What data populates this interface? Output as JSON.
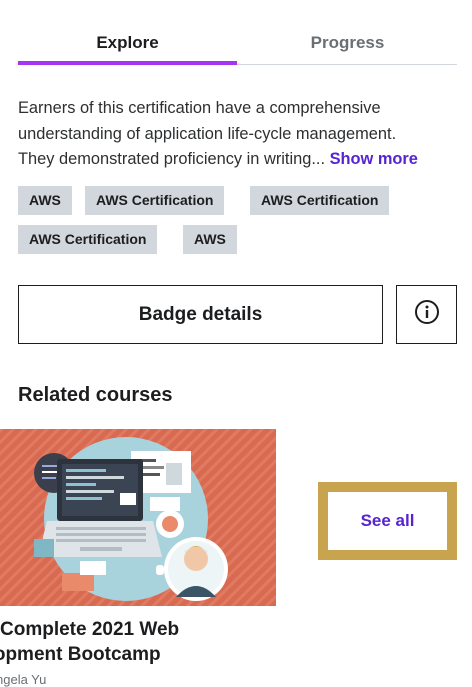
{
  "tabs": [
    {
      "label": "Explore",
      "active": true
    },
    {
      "label": "Progress",
      "active": false
    }
  ],
  "description": {
    "line1": "Earners of this certification have a comprehensive",
    "line2": "understanding of application life-cycle management.",
    "line3": "They demonstrated proficiency in writing...",
    "show_more": "Show more"
  },
  "tags": [
    "AWS",
    "AWS Certification",
    "AWS Certification",
    "AWS Certification",
    "AWS"
  ],
  "actions": {
    "badge_details": "Badge details",
    "info_icon": "info-circle-icon"
  },
  "related": {
    "title": "Related courses",
    "course": {
      "title_line1": "Complete 2021 Web",
      "title_line2": "elopment Bootcamp",
      "author": "ngela Yu"
    },
    "see_all": "See all"
  },
  "colors": {
    "accent": "#a435f0",
    "link": "#5624d0",
    "tag_bg": "#d1d7dc",
    "focus_outline": "#c8a44e",
    "thumbnail_bg": "#d96a52"
  }
}
